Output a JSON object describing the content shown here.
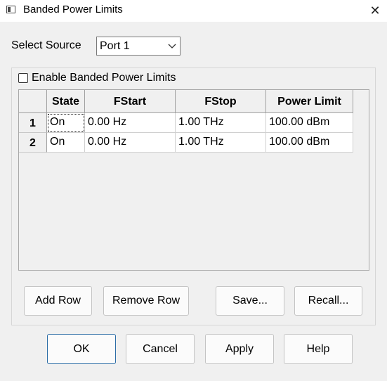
{
  "window": {
    "title": "Banded Power Limits",
    "close_glyph": "✕"
  },
  "source": {
    "label": "Select Source",
    "selected": "Port 1"
  },
  "enable": {
    "label": "Enable Banded Power Limits",
    "checked": false
  },
  "table": {
    "columns": [
      "State",
      "FStart",
      "FStop",
      "Power Limit"
    ],
    "rows": [
      {
        "num": "1",
        "state": "On",
        "fstart": "0.00 Hz",
        "fstop": "1.00 THz",
        "power": "100.00 dBm"
      },
      {
        "num": "2",
        "state": "On",
        "fstart": "0.00 Hz",
        "fstop": "1.00 THz",
        "power": "100.00 dBm"
      }
    ]
  },
  "buttons": {
    "add_row": "Add Row",
    "remove_row": "Remove Row",
    "save": "Save...",
    "recall": "Recall...",
    "ok": "OK",
    "cancel": "Cancel",
    "apply": "Apply",
    "help": "Help"
  }
}
